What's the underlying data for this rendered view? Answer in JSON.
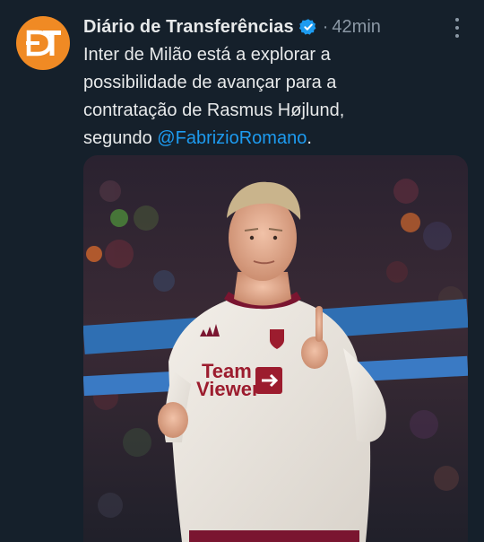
{
  "tweet": {
    "author_name": "Diário de Transferências",
    "avatar_initials": "DT",
    "verified_icon": "verified-badge-icon",
    "separator": "·",
    "time": "42min",
    "more_icon": "more-vertical-icon",
    "text_lines": [
      "Inter de Milão está a explorar a",
      "possibilidade de avançar para a",
      "contratação de Rasmus Højlund,"
    ],
    "text_last_prefix": "segundo ",
    "mention": "@FabrizioRomano",
    "text_last_suffix": "."
  },
  "media": {
    "kit_sponsor_line1": "Team",
    "kit_sponsor_line2": "Viewer"
  },
  "colors": {
    "background": "#15202b",
    "text": "#e7e9ea",
    "muted": "#8b98a5",
    "accent": "#1d9bf0",
    "avatar": "#f08a24"
  }
}
